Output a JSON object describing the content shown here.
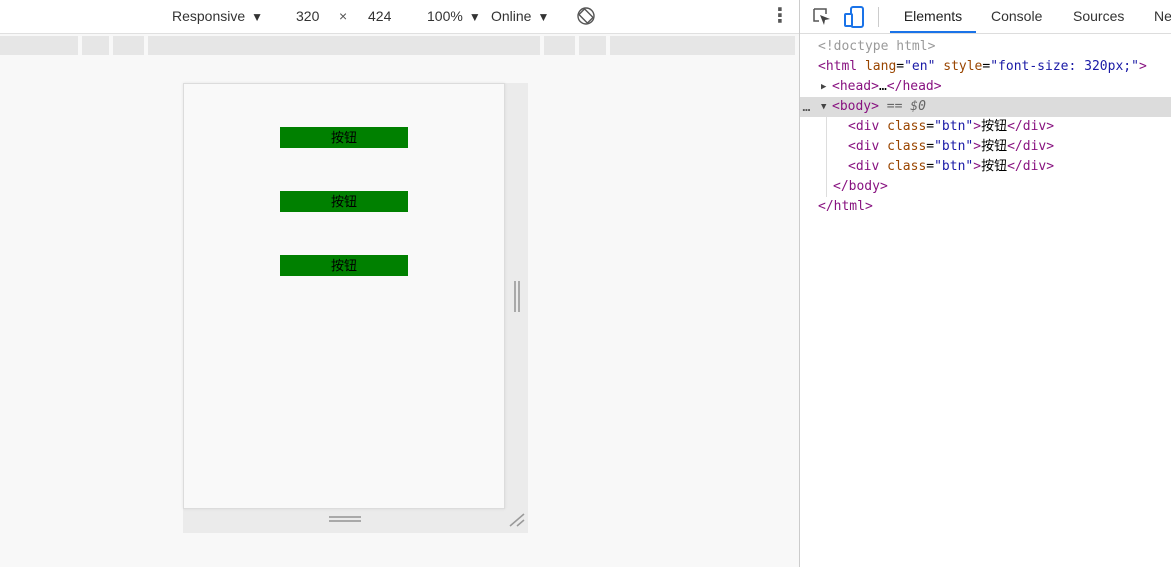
{
  "device_toolbar": {
    "device": "Responsive",
    "width": "320",
    "times": "×",
    "height": "424",
    "zoom": "100%",
    "throttling": "Online",
    "more": "⋮"
  },
  "viewport": {
    "buttons": [
      "按钮",
      "按钮",
      "按钮"
    ]
  },
  "devtools": {
    "tabs": [
      "Elements",
      "Console",
      "Sources",
      "Ne"
    ],
    "active_tab": "Elements",
    "dom": {
      "doctype": "<!doctype html>",
      "html_open_tag": "<html",
      "html_attr1_name": "lang",
      "html_attr1_value": "\"en\"",
      "html_attr2_name": "style",
      "html_attr2_value": "\"font-size: 320px;\"",
      "gt": ">",
      "head_open": "<head>",
      "ellipsis": "…",
      "head_close": "</head>",
      "body_open": "<body>",
      "selected_marker": "== $0",
      "dots": "...",
      "div_open": "<div",
      "class_attr": "class",
      "btn_value": "\"btn\"",
      "eq": "=",
      "div_text": "按钮",
      "div_close": "</div>",
      "body_close": "</body>",
      "html_close": "</html>"
    }
  },
  "colors": {
    "button_bg": "#008000",
    "active_tab_underline": "#1a73e8",
    "tag": "#881280",
    "attr_name": "#994500",
    "attr_value": "#1a1aa6"
  },
  "icons": {
    "inspect": "inspect-element-icon",
    "device": "device-toggle-icon",
    "rotate": "rotate-icon"
  }
}
